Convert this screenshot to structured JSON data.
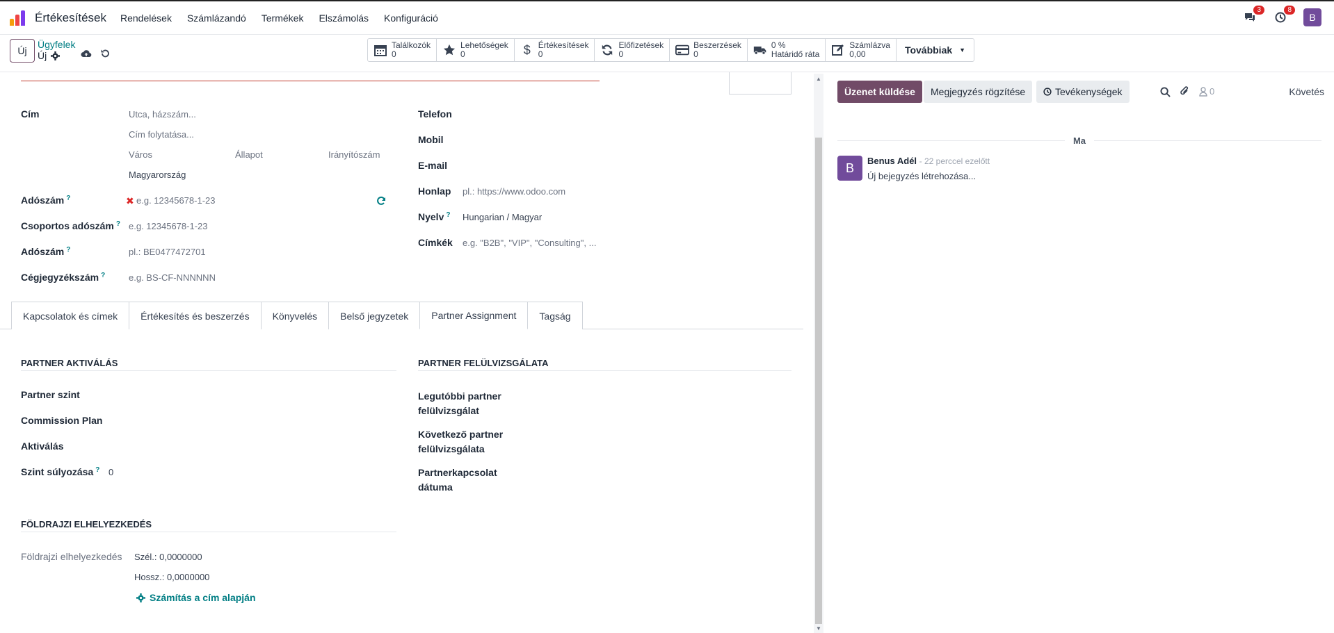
{
  "top": {
    "app_name": "Értékesítések",
    "menu": [
      "Rendelések",
      "Számlázandó",
      "Termékek",
      "Elszámolás",
      "Konfiguráció"
    ],
    "messages_badge": "3",
    "activities_badge": "8",
    "user_initial": "B"
  },
  "control": {
    "new_label": "Új",
    "breadcrumb_link": "Ügyfelek",
    "breadcrumb_current": "Új",
    "smart_buttons": [
      {
        "label": "Találkozók",
        "value": "0",
        "icon": "calendar-icon"
      },
      {
        "label": "Lehetőségek",
        "value": "0",
        "icon": "star-icon"
      },
      {
        "label": "Értékesítések",
        "value": "0",
        "icon": "dollar-icon"
      },
      {
        "label": "Előfizetések",
        "value": "0",
        "icon": "refresh-icon"
      },
      {
        "label": "Beszerzések",
        "value": "0",
        "icon": "credit-card-icon"
      },
      {
        "label": "0 %",
        "value": "Határidő ráta",
        "icon": "truck-icon"
      },
      {
        "label": "Számlázva",
        "value": "0,00",
        "icon": "edit-icon"
      }
    ],
    "more_label": "Továbbiak"
  },
  "form": {
    "address_label": "Cím",
    "street_ph": "Utca, házszám...",
    "street2_ph": "Cím folytatása...",
    "city_ph": "Város",
    "state_ph": "Állapot",
    "zip_ph": "Irányítószám",
    "country": "Magyarország",
    "vat_label": "Adószám",
    "vat_ph": "e.g. 12345678-1-23",
    "group_vat_label": "Csoportos adószám",
    "group_vat_ph": "e.g. 12345678-1-23",
    "vat2_label": "Adószám",
    "vat2_ph": "pl.: BE0477472701",
    "company_reg_label": "Cégjegyzékszám",
    "company_reg_ph": "e.g. BS-CF-NNNNNN",
    "phone_label": "Telefon",
    "mobile_label": "Mobil",
    "email_label": "E-mail",
    "website_label": "Honlap",
    "website_ph": "pl.: https://www.odoo.com",
    "lang_label": "Nyelv",
    "lang_value": "Hungarian / Magyar",
    "tags_label": "Címkék",
    "tags_ph": "e.g. \"B2B\", \"VIP\", \"Consulting\", ..."
  },
  "tabs": [
    "Kapcsolatok és címek",
    "Értékesítés és beszerzés",
    "Könyvelés",
    "Belső jegyzetek",
    "Partner Assignment",
    "Tagság"
  ],
  "partner": {
    "activation_h": "PARTNER AKTIVÁLÁS",
    "level_label": "Partner szint",
    "commission_label": "Commission Plan",
    "activation_label": "Aktiválás",
    "weight_label": "Szint súlyozása",
    "weight_value": "0",
    "review_h": "PARTNER FELÜLVIZSGÁLATA",
    "last_review_l1": "Legutóbbi partner",
    "last_review_l2": "felülvizsgálat",
    "next_review_l1": "Következő partner",
    "next_review_l2": "felülvizsgálata",
    "partnership_l1": "Partnerkapcsolat",
    "partnership_l2": "dátuma",
    "geo_h": "FÖLDRAJZI ELHELYEZKEDÉS",
    "geo_label": "Földrajzi elhelyezkedés",
    "lat": "Szél.: 0,0000000",
    "lng": "Hossz.: 0,0000000",
    "compute_label": "Számítás a cím alapján"
  },
  "chatter": {
    "send_message": "Üzenet küldése",
    "log_note": "Megjegyzés rögzítése",
    "activities": "Tevékenységek",
    "followers_count": "0",
    "follow": "Követés",
    "day_label": "Ma",
    "author": "Benus Adél",
    "time": "- 22 perccel ezelőtt",
    "body": "Új bejegyzés létrehozása...",
    "avatar_initial": "B"
  },
  "colors": {
    "brand": "#714b67",
    "link": "#017e84",
    "avatar": "#714b9b",
    "badge": "#dc2626"
  }
}
